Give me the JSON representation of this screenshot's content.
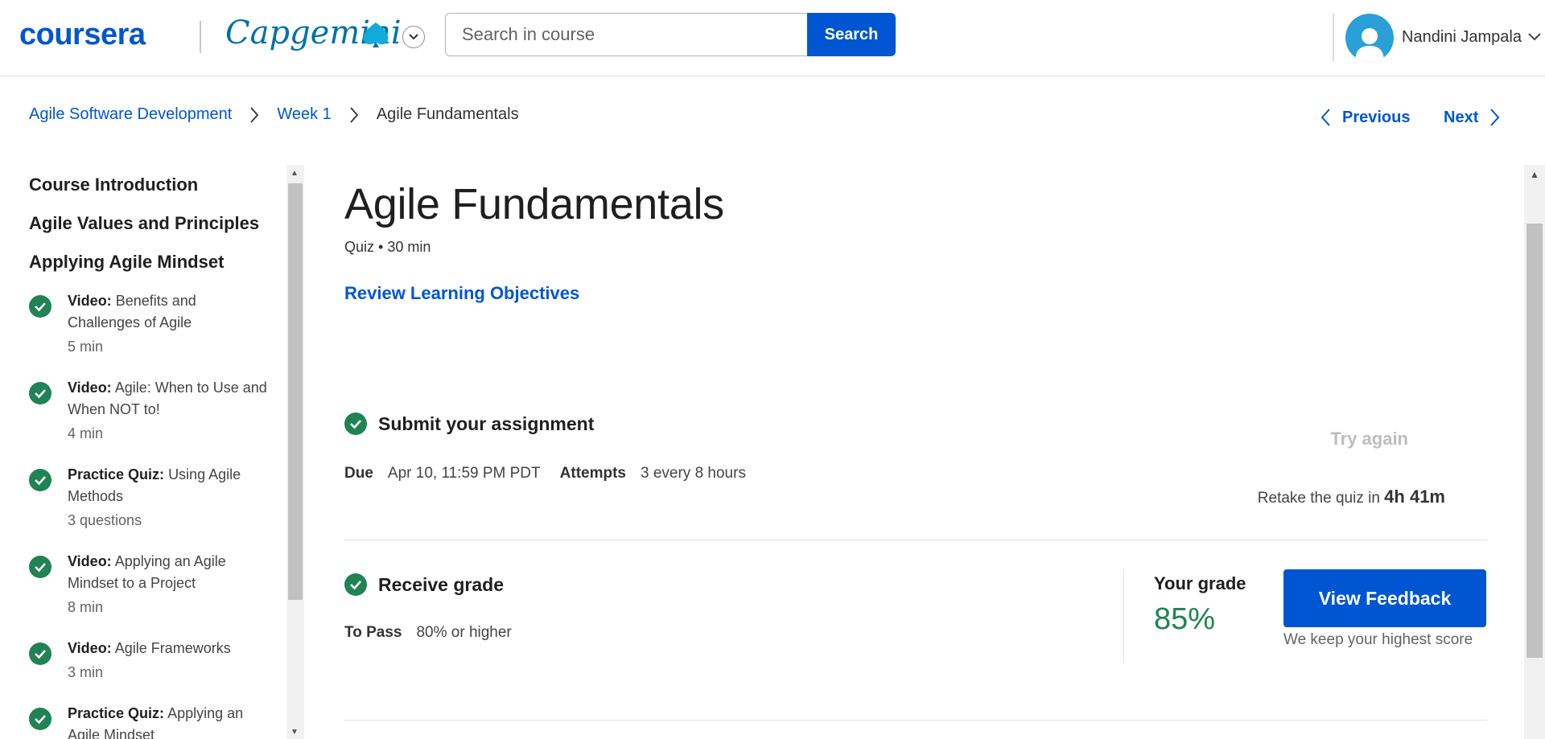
{
  "header": {
    "brand": "coursera",
    "partner": "Capgemini",
    "search_placeholder": "Search in course",
    "search_button": "Search",
    "user_name": "Nandini Jampala",
    "colors": {
      "brand": "#0056d2",
      "partner": "#0070ad",
      "avatar": "#2a9fd8"
    }
  },
  "breadcrumb": {
    "course": "Agile Software Development",
    "week": "Week 1",
    "current": "Agile Fundamentals"
  },
  "nav": {
    "previous": "Previous",
    "next": "Next"
  },
  "sidebar": {
    "sections": [
      "Course Introduction",
      "Agile Values and Principles",
      "Applying Agile Mindset"
    ],
    "items": [
      {
        "kind": "Video:",
        "title": "Benefits and Challenges of Agile",
        "meta": "5 min",
        "status": "completed"
      },
      {
        "kind": "Video:",
        "title": "Agile: When to Use and When NOT to!",
        "meta": "4 min",
        "status": "completed"
      },
      {
        "kind": "Practice Quiz:",
        "title": "Using Agile Methods",
        "meta": "3 questions",
        "status": "completed"
      },
      {
        "kind": "Video:",
        "title": "Applying an Agile Mindset to a Project",
        "meta": "8 min",
        "status": "completed"
      },
      {
        "kind": "Video:",
        "title": "Agile Frameworks",
        "meta": "3 min",
        "status": "completed"
      },
      {
        "kind": "Practice Quiz:",
        "title": "Applying an Agile Mindset",
        "meta": "",
        "status": "completed"
      }
    ]
  },
  "main": {
    "title": "Agile Fundamentals",
    "subtitle": "Quiz • 30 min",
    "review_link": "Review Learning Objectives",
    "submit": {
      "heading": "Submit your assignment",
      "due_label": "Due",
      "due_value": "Apr 10, 11:59 PM PDT",
      "attempts_label": "Attempts",
      "attempts_value": "3 every 8 hours",
      "try_again": "Try again",
      "retake_prefix": "Retake the quiz in",
      "retake_time": "4h 41m"
    },
    "grade": {
      "heading": "Receive grade",
      "to_pass_label": "To Pass",
      "to_pass_value": "80% or higher",
      "your_grade_label": "Your grade",
      "your_grade_value": "85%",
      "feedback_button": "View Feedback",
      "keep_note": "We keep your highest score"
    },
    "colors": {
      "success": "#1f8354",
      "disabled": "#bdbdbd"
    }
  }
}
